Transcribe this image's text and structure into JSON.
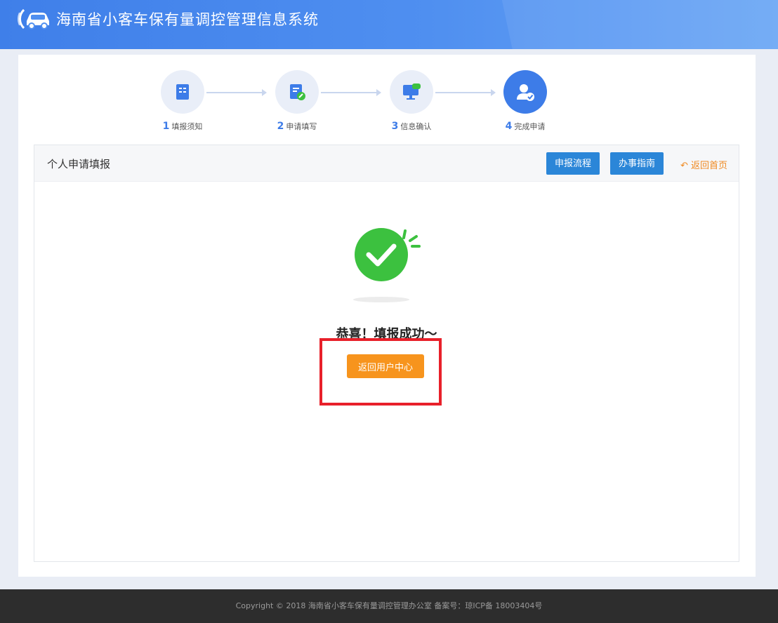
{
  "header": {
    "title": "海南省小客车保有量调控管理信息系统"
  },
  "steps": [
    {
      "num": "1",
      "label": "填报须知"
    },
    {
      "num": "2",
      "label": "申请填写"
    },
    {
      "num": "3",
      "label": "信息确认"
    },
    {
      "num": "4",
      "label": "完成申请"
    }
  ],
  "steps_active": 4,
  "panel": {
    "title": "个人申请填报",
    "buttons": {
      "process": "申报流程",
      "guide": "办事指南",
      "back_home": "返回首页"
    }
  },
  "success": {
    "message": "恭喜！填报成功～",
    "button": "返回用户中心"
  },
  "footer": {
    "text": "Copyright © 2018 海南省小客车保有量调控管理办公室 备案号：琼ICP备 18003404号"
  },
  "colors": {
    "primary": "#3d7ce8",
    "button_blue": "#2b86d8",
    "accent_orange": "#f7941d",
    "success_green": "#3cc13f",
    "highlight_red": "#e8202a"
  }
}
